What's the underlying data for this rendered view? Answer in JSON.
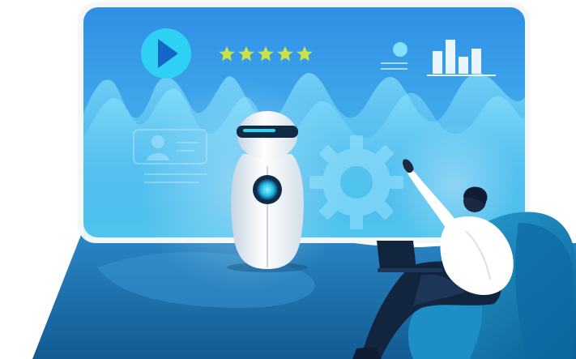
{
  "rating": {
    "stars": 5,
    "max": 5
  },
  "icons": [
    "play-button-icon",
    "star-icon",
    "user-profile-icon",
    "gear-icon",
    "bar-chart-icon",
    "robot-icon",
    "laptop-icon"
  ],
  "colors": {
    "screen_top": "#2f8fe6",
    "screen_bottom": "#52c6ee",
    "wave": "#7fe3ff",
    "play_circle": "#2ed1f4",
    "play_arrow": "#1466c8",
    "star": "#c9e24a",
    "chart_bars": "#e9f6ff",
    "floor_blue": "#1b6fae",
    "chair": "#1682b8",
    "robot_visor": "#0f2b46",
    "robot_core": "#2ad4f2",
    "shirt": "#ffffff",
    "pants": "#12253f",
    "hair": "#0f1d33",
    "skin": "#1b2940"
  }
}
